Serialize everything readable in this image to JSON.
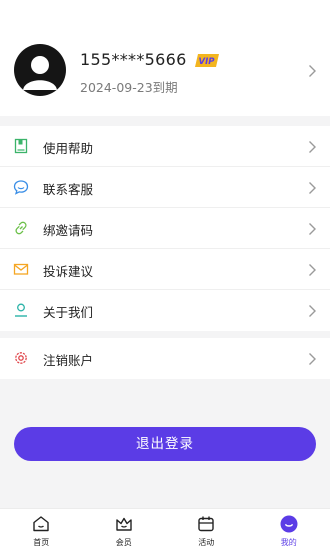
{
  "profile": {
    "phone": "155****5666",
    "vip_badge": "VIP",
    "expire_text": "2024-09-23到期"
  },
  "menu_group_main": [
    {
      "label": "使用帮助",
      "icon": "help-book-icon",
      "color": "#3bb36a"
    },
    {
      "label": "联系客服",
      "icon": "chat-bubble-icon",
      "color": "#3a8ee6"
    },
    {
      "label": "绑邀请码",
      "icon": "link-icon",
      "color": "#6cc04a"
    },
    {
      "label": "投诉建议",
      "icon": "envelope-icon",
      "color": "#f5a623"
    },
    {
      "label": "关于我们",
      "icon": "person-icon",
      "color": "#2bb3a8"
    }
  ],
  "menu_group_account": [
    {
      "label": "注销账户",
      "icon": "gear-icon",
      "color": "#e0474c"
    }
  ],
  "logout_label": "退出登录",
  "tabbar": [
    {
      "label": "首页",
      "icon": "home-icon",
      "active": false
    },
    {
      "label": "会员",
      "icon": "crown-icon",
      "active": false
    },
    {
      "label": "活动",
      "icon": "calendar-icon",
      "active": false
    },
    {
      "label": "我的",
      "icon": "profile-face-icon",
      "active": true
    }
  ],
  "colors": {
    "accent": "#5b3ce6",
    "vip_gold": "#f3b51f",
    "background": "#f4f4f5"
  }
}
